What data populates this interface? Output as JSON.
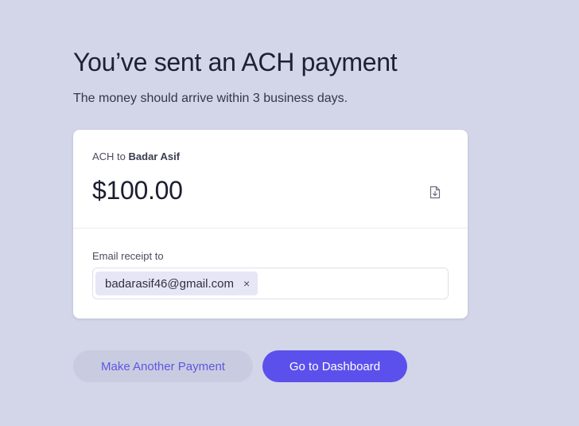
{
  "header": {
    "title": "You’ve sent an ACH payment",
    "subtitle": "The money should arrive within 3 business days."
  },
  "payment": {
    "method_prefix": "ACH to ",
    "recipient": "Badar Asif",
    "amount": "$100.00",
    "download_icon": "file-download-icon"
  },
  "receipt": {
    "label": "Email receipt to",
    "emails": [
      "badarasif46@gmail.com"
    ],
    "remove_glyph": "×"
  },
  "actions": {
    "secondary_label": "Make Another Payment",
    "primary_label": "Go to Dashboard"
  },
  "colors": {
    "background": "#d3d6e8",
    "accent": "#5b50ec",
    "chip": "#e6e6f7"
  }
}
